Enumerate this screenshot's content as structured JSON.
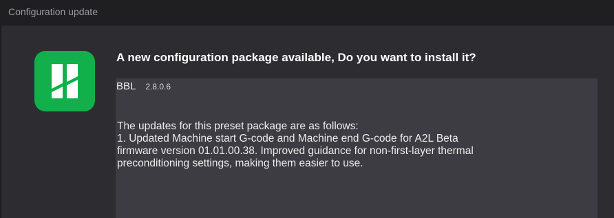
{
  "window": {
    "title": "Configuration update"
  },
  "icon": {
    "name": "bambu-studio-app-icon",
    "color": "#12b04a"
  },
  "dialog": {
    "heading": "A new configuration package available, Do you want to install it?",
    "package_name": "BBL",
    "package_version": "2.8.0.6",
    "notes_lines": [
      "The updates for this preset package are as follows:",
      "1. Updated Machine start G-code and Machine end G-code for A2L Beta",
      "firmware version 01.01.00.38. Improved guidance for non-first-layer thermal",
      "preconditioning settings, making them easier to use."
    ]
  }
}
